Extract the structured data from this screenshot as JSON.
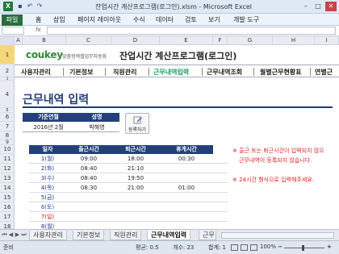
{
  "window": {
    "title": "잔업시간 계산프로그램(로그인).xlsm - Microsoft Excel",
    "app_icon_letter": "X",
    "quick_access": [
      "save-icon",
      "undo-icon",
      "redo-icon"
    ],
    "controls": [
      "minimize-icon",
      "maximize-icon",
      "close-icon"
    ]
  },
  "ribbon": {
    "tabs": [
      "파일",
      "홈",
      "삽입",
      "페이지 레이아웃",
      "수식",
      "데이터",
      "검토",
      "보기",
      "개발 도구"
    ]
  },
  "formula_bar": {
    "name_box": "",
    "fx": "fx",
    "value": ""
  },
  "columns": [
    "A",
    "B",
    "C",
    "D",
    "E",
    "F",
    "G",
    "H",
    "I"
  ],
  "rows": [
    "1",
    "2",
    "3",
    "4",
    "5",
    "6",
    "7",
    "8",
    "9",
    "10",
    "11",
    "12",
    "13",
    "14",
    "15",
    "16",
    "17",
    "18"
  ],
  "selected_row": "1",
  "logo": {
    "brand": "coukey",
    "sub": "맞춤형엑셀업무자동화"
  },
  "app_title": "잔업시간 계산프로그램(로그인)",
  "nav": [
    "사용자관리",
    "기본정보",
    "직원관리",
    "근무내역입력",
    "근무내역조회",
    "월별근무현황표",
    "연별근"
  ],
  "nav_active": "근무내역입력",
  "page_title": "근무내역 입력",
  "criteria": {
    "year_month_header": "기준연월",
    "name_header": "성명",
    "year_month_value": "2016년 2월",
    "name_value": "박해영"
  },
  "register_button": "등록하기",
  "table": {
    "headers": [
      "일자",
      "출근시간",
      "퇴근시간",
      "휴게시간"
    ],
    "rows": [
      {
        "day": "1(월)",
        "in": "09:00",
        "out": "18:00",
        "rest": "00:30",
        "kind": "d"
      },
      {
        "day": "2(화)",
        "in": "08:40",
        "out": "21:10",
        "rest": "",
        "kind": "d"
      },
      {
        "day": "3(수)",
        "in": "08:40",
        "out": "19:50",
        "rest": "",
        "kind": "d"
      },
      {
        "day": "4(목)",
        "in": "08:30",
        "out": "21:00",
        "rest": "01:00",
        "kind": "d"
      },
      {
        "day": "5(금)",
        "in": "",
        "out": "",
        "rest": "",
        "kind": "d"
      },
      {
        "day": "6(토)",
        "in": "",
        "out": "",
        "rest": "",
        "kind": "sat"
      },
      {
        "day": "7(일)",
        "in": "",
        "out": "",
        "rest": "",
        "kind": "sun"
      },
      {
        "day": "8(월)",
        "in": "",
        "out": "",
        "rest": "",
        "kind": "d"
      }
    ]
  },
  "notes": [
    "※ 출근 또는 퇴근시간이 입력되지 않으",
    "근무내역이 등록되지 않습니다.",
    "※ 24시간 형식으로 입력해주세요."
  ],
  "sheet_tabs": [
    "사용자관리",
    "기본정보",
    "직원관리",
    "근무내역입력",
    "근무"
  ],
  "active_sheet": "근무내역입력",
  "status": {
    "mode": "준비",
    "average": "평균: 0.5",
    "count": "개수: 23",
    "sum": "합계: 1",
    "zoom": "100%"
  },
  "colors": {
    "header_navy": "#23407a",
    "active_nav_green": "#1d9e5a",
    "note_red": "#e02020",
    "excel_green": "#2a6e3f"
  }
}
